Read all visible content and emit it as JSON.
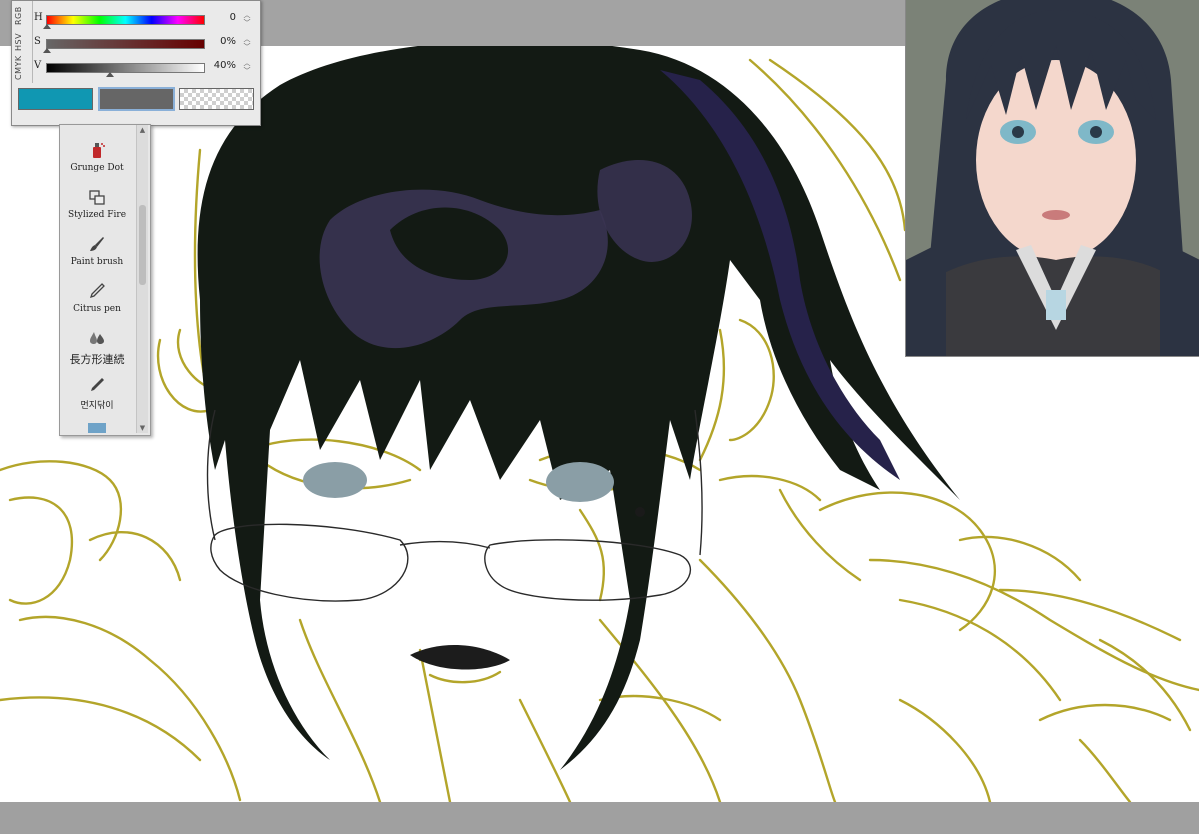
{
  "color_panel": {
    "modes": [
      "RGB",
      "HSV",
      "CMYK"
    ],
    "sliders": [
      {
        "letter": "H",
        "value": "0"
      },
      {
        "letter": "S",
        "value": "0%"
      },
      {
        "letter": "V",
        "value": "40%"
      }
    ],
    "swatches": {
      "main_color": "#1097b2",
      "sub_color": "#666666",
      "transparent": "transparent"
    }
  },
  "brush_palette": {
    "items": [
      {
        "label": "Grunge Dot",
        "icon": "spray-icon"
      },
      {
        "label": "Stylized Fire",
        "icon": "stamp-icon"
      },
      {
        "label": "Paint brush",
        "icon": "brush-icon"
      },
      {
        "label": "Citrus pen",
        "icon": "pen-icon"
      },
      {
        "label": "長方形連続",
        "icon": "droplets-icon"
      },
      {
        "label": "먼지닦이",
        "icon": "pen-icon"
      }
    ],
    "scroll_up": "▲",
    "scroll_down": "▼",
    "spin_up": "︿",
    "spin_down": "﹀"
  },
  "colors": {
    "hair": "#131a14",
    "sketch": "#b3a52a",
    "hair_highlight": "#3a3452"
  }
}
